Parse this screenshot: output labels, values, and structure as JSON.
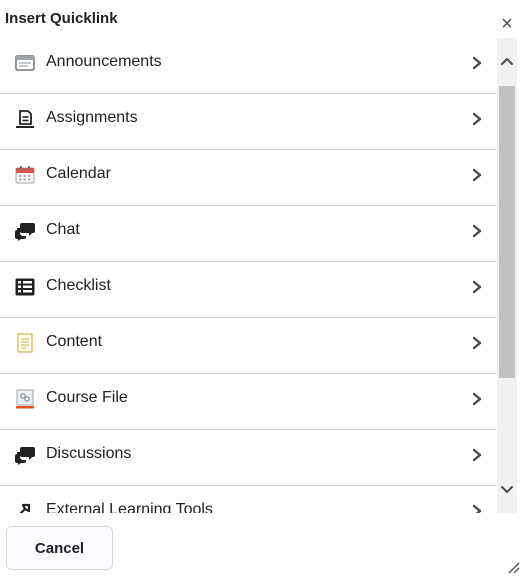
{
  "dialog": {
    "title": "Insert Quicklink",
    "close_glyph": "×"
  },
  "items": [
    {
      "label": "Announcements",
      "icon": "announcements-icon"
    },
    {
      "label": "Assignments",
      "icon": "assignments-icon"
    },
    {
      "label": "Calendar",
      "icon": "calendar-icon"
    },
    {
      "label": "Chat",
      "icon": "chat-icon"
    },
    {
      "label": "Checklist",
      "icon": "checklist-icon"
    },
    {
      "label": "Content",
      "icon": "content-icon"
    },
    {
      "label": "Course File",
      "icon": "course-file-icon"
    },
    {
      "label": "Discussions",
      "icon": "discussions-icon"
    },
    {
      "label": "External Learning Tools",
      "icon": "external-learning-tools-icon"
    }
  ],
  "footer": {
    "cancel_label": "Cancel"
  },
  "colors": {
    "divider": "#d3d9e3",
    "scroll_track": "#f1f1f1",
    "scroll_thumb": "#c1c1c1",
    "calendar_red": "#d9534f",
    "course_file_orange": "#e5531a"
  }
}
